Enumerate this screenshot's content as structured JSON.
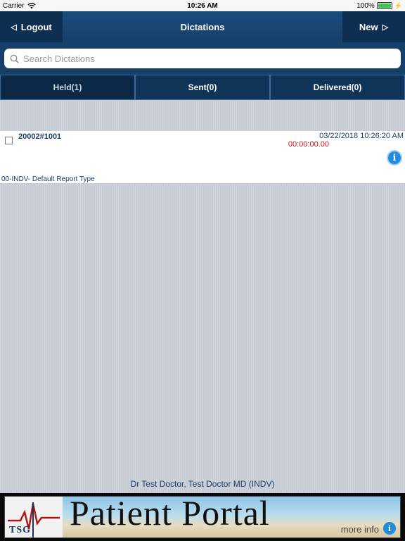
{
  "status_bar": {
    "carrier": "Carrier",
    "time": "10:26 AM",
    "battery": "100%",
    "battery_level": 1.0
  },
  "nav": {
    "left_button": "Logout",
    "title": "Dictations",
    "right_button": "New"
  },
  "search": {
    "placeholder": "Search Dictations",
    "value": ""
  },
  "tabs": [
    {
      "label": "Held(1)",
      "active": true
    },
    {
      "label": "Sent(0)",
      "active": false
    },
    {
      "label": "Delivered(0)",
      "active": false
    }
  ],
  "list": {
    "items": [
      {
        "id": "20002#1001",
        "datetime": "03/22/2018 10:26:20 AM",
        "duration": "00:00:00.00",
        "report_type": "00-INDV- Default Report Type",
        "checked": false
      }
    ]
  },
  "footer": {
    "doctor": "Dr Test Doctor, Test Doctor MD (INDV)"
  },
  "banner": {
    "logo_text": "TSG",
    "title": "Patient Portal",
    "more": "more info",
    "info_glyph": "i"
  },
  "colors": {
    "nav": "#163f6a",
    "button": "#0e2f52",
    "accent_red": "#d01010",
    "text_blue": "#1a3d6b"
  }
}
